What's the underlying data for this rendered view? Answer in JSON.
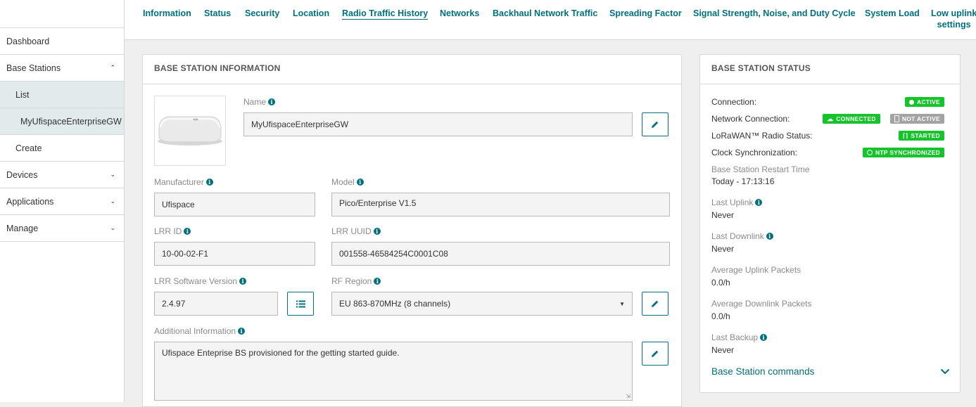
{
  "sidebar": {
    "items": [
      {
        "label": "Dashboard"
      },
      {
        "label": "Base Stations"
      },
      {
        "label": "List"
      },
      {
        "label": "MyUfispaceEnterpriseGW"
      },
      {
        "label": "Create"
      },
      {
        "label": "Devices"
      },
      {
        "label": "Applications"
      },
      {
        "label": "Manage"
      }
    ]
  },
  "tabs": [
    {
      "label": "Information"
    },
    {
      "label": "Status"
    },
    {
      "label": "Security"
    },
    {
      "label": "Location"
    },
    {
      "label": "Radio Traffic History"
    },
    {
      "label": "Networks"
    },
    {
      "label": "Backhaul Network Traffic"
    },
    {
      "label": "Spreading Factor"
    },
    {
      "label": "Signal Strength, Noise, and Duty Cycle"
    },
    {
      "label": "System Load"
    },
    {
      "label_line1": "Low uplink",
      "label_line2": "settings"
    }
  ],
  "active_tab": "Radio Traffic History",
  "info_panel": {
    "title": "BASE STATION INFORMATION",
    "name_label": "Name",
    "name_value": "MyUfispaceEnterpriseGW",
    "manufacturer_label": "Manufacturer",
    "manufacturer_value": "Ufispace",
    "model_label": "Model",
    "model_value": "Pico/Enterprise V1.5",
    "lrr_id_label": "LRR ID",
    "lrr_id_value": "10-00-02-F1",
    "lrr_uuid_label": "LRR UUID",
    "lrr_uuid_value": "001558-46584254C0001C08",
    "sw_label": "LRR Software Version",
    "sw_value": "2.4.97",
    "rf_label": "RF Region",
    "rf_value": "EU 863-870MHz (8 channels)",
    "addl_label": "Additional Information",
    "addl_value": "Ufispace Enteprise BS provisioned for the getting started guide."
  },
  "status_panel": {
    "title": "BASE STATION STATUS",
    "connection_label": "Connection:",
    "connection_badge": "ACTIVE",
    "network_label": "Network Connection:",
    "network_badge_1": "CONNECTED",
    "network_badge_2": "NOT ACTIVE",
    "radio_label": "LoRaWAN™ Radio Status:",
    "radio_badge": "STARTED",
    "clock_label": "Clock Synchronization:",
    "clock_badge": "NTP SYNCHRONIZED",
    "restart_label": "Base Station Restart Time",
    "restart_value": "Today - 17:13:16",
    "uplink_label": "Last Uplink",
    "uplink_value": "Never",
    "downlink_label": "Last Downlink",
    "downlink_value": "Never",
    "avg_up_label": "Average Uplink Packets",
    "avg_up_value": "0.0/h",
    "avg_down_label": "Average Downlink Packets",
    "avg_down_value": "0.0/h",
    "backup_label": "Last Backup",
    "backup_value": "Never",
    "commands_label": "Base Station commands"
  },
  "colors": {
    "accent": "#00707c",
    "badge_green": "#15c42a",
    "badge_grey": "#a3a3a3"
  }
}
